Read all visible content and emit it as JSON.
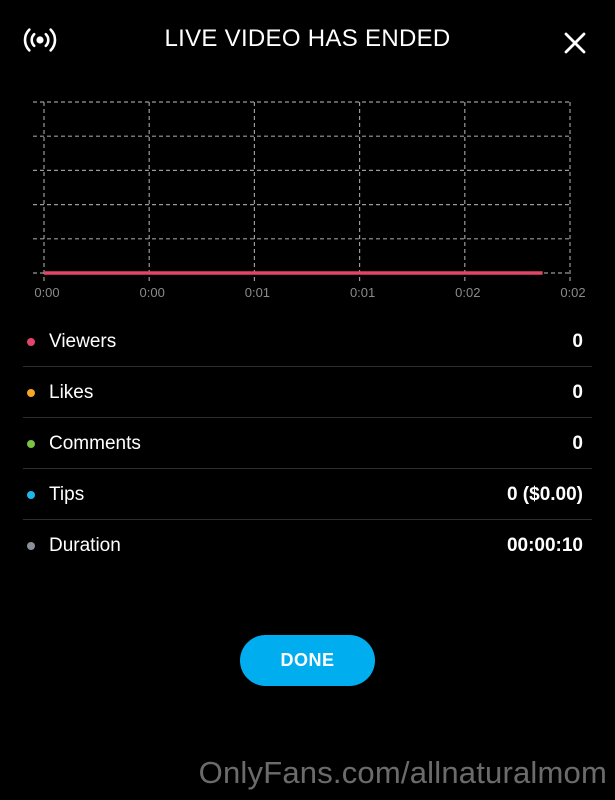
{
  "header": {
    "title": "LIVE VIDEO HAS ENDED",
    "live_icon": "broadcast-icon",
    "close_icon": "close-icon"
  },
  "chart_data": {
    "type": "line",
    "x_tick_labels": [
      "0:00",
      "0:00",
      "0:01",
      "0:01",
      "0:02",
      "0:02"
    ],
    "series": [
      {
        "color": "#e2456a",
        "x": [
          0,
          0.0237
        ],
        "y": [
          0,
          0
        ]
      }
    ],
    "xlim": [
      0,
      0.025
    ],
    "ylim": [
      0,
      1
    ],
    "grid": true,
    "grid_style": "dashed",
    "grid_color": "#9a9a9a"
  },
  "stats": [
    {
      "label": "Viewers",
      "value": "0",
      "color": "#e2456a"
    },
    {
      "label": "Likes",
      "value": "0",
      "color": "#f5a623"
    },
    {
      "label": "Comments",
      "value": "0",
      "color": "#7dc242"
    },
    {
      "label": "Tips",
      "value": "0 ($0.00)",
      "color": "#1fb6e8"
    },
    {
      "label": "Duration",
      "value": "00:00:10",
      "color": "#8a8f99"
    }
  ],
  "done_button": {
    "label": "DONE",
    "color": "#00aeef"
  },
  "watermark": "OnlyFans.com/allnaturalmom"
}
